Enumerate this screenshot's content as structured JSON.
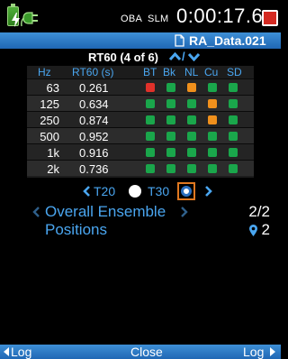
{
  "status": {
    "mode_oba": "OBA",
    "mode_slm": "SLM",
    "timer": "0:00:17.6"
  },
  "file": {
    "name": "RA_Data.021"
  },
  "metric": {
    "title": "RT60 (4 of 6)",
    "separator": "/"
  },
  "table": {
    "headers": [
      "Hz",
      "RT60 (s)",
      "BT",
      "Bk",
      "NL",
      "Cu",
      "SD"
    ],
    "rows": [
      {
        "hz": "63",
        "rt60": "0.261",
        "flags": [
          "red",
          "green",
          "orange",
          "green",
          "green"
        ]
      },
      {
        "hz": "125",
        "rt60": "0.634",
        "flags": [
          "green",
          "green",
          "green",
          "orange",
          "green"
        ]
      },
      {
        "hz": "250",
        "rt60": "0.874",
        "flags": [
          "green",
          "green",
          "green",
          "orange",
          "green"
        ]
      },
      {
        "hz": "500",
        "rt60": "0.952",
        "flags": [
          "green",
          "green",
          "green",
          "green",
          "green"
        ]
      },
      {
        "hz": "1k",
        "rt60": "0.916",
        "flags": [
          "green",
          "green",
          "green",
          "green",
          "green"
        ]
      },
      {
        "hz": "2k",
        "rt60": "0.736",
        "flags": [
          "green",
          "green",
          "green",
          "green",
          "green"
        ]
      }
    ]
  },
  "colors": {
    "green": "#1aa64b",
    "red": "#e0312a",
    "orange": "#f0901c",
    "accent_blue": "#4aa6f0"
  },
  "selector": {
    "t20_label": "T20",
    "t30_label": "T30",
    "selected": "T30"
  },
  "lists": {
    "ensemble_label": "Overall Ensemble",
    "ensemble_count": "2/2",
    "positions_label": "Positions",
    "positions_count": "2"
  },
  "bottom_bar": {
    "left_label": "Log",
    "center_label": "Close",
    "right_label": "Log"
  },
  "icons": {
    "battery": "battery-charging-icon",
    "plug": "power-plug-icon",
    "stop": "stop-record-icon",
    "file": "file-icon",
    "sort_up": "chevron-up-icon",
    "sort_down": "chevron-down-icon",
    "pin": "location-pin-icon"
  }
}
